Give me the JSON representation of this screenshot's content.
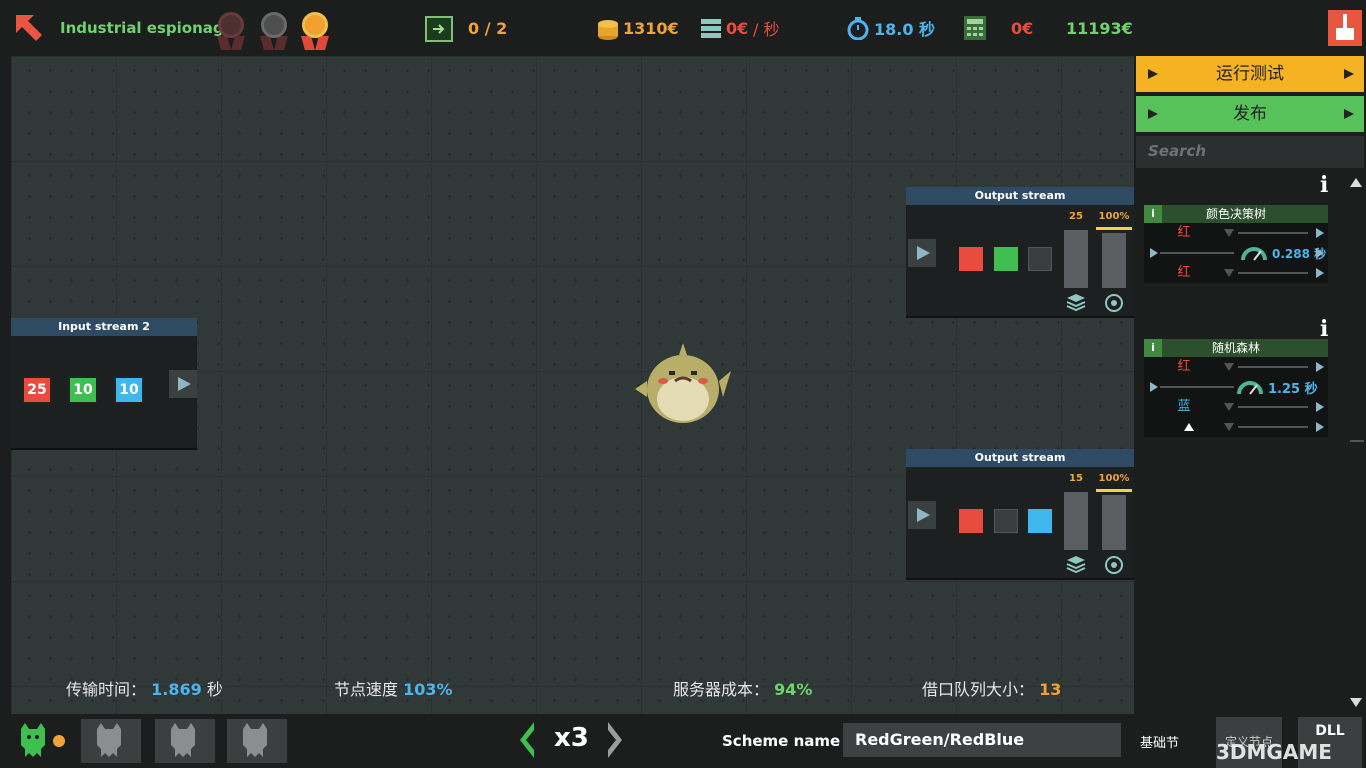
{
  "header": {
    "mission_title": "Industrial espionage",
    "progress": "0 / 2",
    "coins": "1310€",
    "cost_rate_value": "0€",
    "cost_rate_unit": "/ 秒",
    "timer": "18.0 秒",
    "budget": "0€",
    "total": "11193€"
  },
  "nodes": {
    "input_stream": {
      "title": "Input stream 2",
      "values": [
        "25",
        "10",
        "10"
      ]
    },
    "output_1": {
      "title": "Output stream",
      "count": "25",
      "percent": "100%"
    },
    "output_2": {
      "title": "Output stream",
      "count": "15",
      "percent": "100%"
    }
  },
  "stats": {
    "transfer_label": "传输时间：",
    "transfer_value": "1.869",
    "transfer_unit": "秒",
    "speed_label": "节点速度",
    "speed_value": "103%",
    "server_label": "服务器成本：",
    "server_value": "94%",
    "queue_label": "借口队列大小：",
    "queue_value": "13"
  },
  "right_panel": {
    "run_test": "运行测试",
    "publish": "发布",
    "search_placeholder": "Search",
    "lib1": {
      "title": "颜色决策树",
      "in1": "红",
      "in2": "红",
      "time": "0.288 秒"
    },
    "lib2": {
      "title": "随机森林",
      "in1": "红",
      "in2": "蓝",
      "time": "1.25 秒"
    }
  },
  "bottom": {
    "zoom": "x3",
    "scheme_label": "Scheme name :",
    "scheme_value": "RedGreen/RedBlue",
    "basic_tab": "基础节",
    "custom_tab": "定义节点",
    "dll_tab": "DLL",
    "watermark": "3DMGAME"
  },
  "colors": {
    "red": "#e94b3c",
    "green": "#3fbf4f",
    "blue": "#3db7ee",
    "gray": "#3a3d3e",
    "yellow_btn": "#f5b324",
    "green_btn": "#57c25a"
  }
}
